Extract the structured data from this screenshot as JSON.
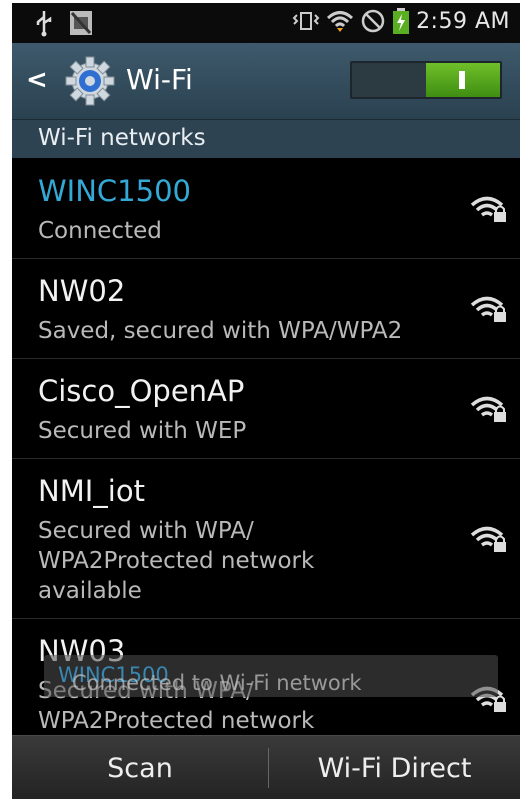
{
  "status_bar": {
    "time": "2:59 AM",
    "icons": [
      "usb-icon",
      "no-sim-icon",
      "vibrate-icon",
      "wifi-status-icon",
      "block-icon",
      "battery-charging-icon"
    ]
  },
  "action_bar": {
    "title": "Wi-Fi",
    "toggle_state": "on",
    "toggle_color": "#5aae22"
  },
  "section_header": "Wi-Fi networks",
  "networks": [
    {
      "name": "WINC1500",
      "status": "Connected",
      "connected": true
    },
    {
      "name": "NW02",
      "status": "Saved, secured with WPA/WPA2",
      "connected": false
    },
    {
      "name": "Cisco_OpenAP",
      "status": "Secured with WEP",
      "connected": false
    },
    {
      "name": "NMI_iot",
      "status": "Secured with WPA/ WPA2Protected network available",
      "connected": false
    },
    {
      "name": "NW03",
      "status": "Secured with WPA/ WPA2Protected network",
      "connected": false
    }
  ],
  "toast": {
    "prefix": "Connected to Wi-Fi network ",
    "network": "WINC1500"
  },
  "bottom_bar": {
    "scan_label": "Scan",
    "direct_label": "Wi-Fi Direct"
  },
  "colors": {
    "connected_text": "#34a9d6",
    "action_bar": "#354f60"
  }
}
